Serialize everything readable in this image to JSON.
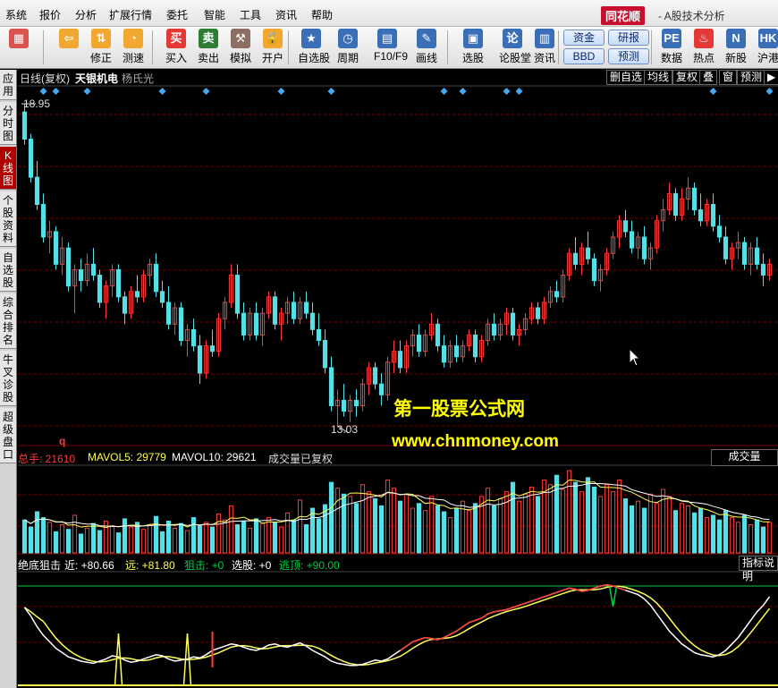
{
  "menu": [
    "系统",
    "报价",
    "分析",
    "扩展行情",
    "委托",
    "智能",
    "工具",
    "资讯",
    "帮助"
  ],
  "brand": "同花顺",
  "window_title": "- A股技术分析",
  "toolbar": {
    "buttons": [
      {
        "label": "",
        "icon": "app-grid-icon",
        "color": "#d9534f"
      },
      {
        "label": "",
        "icon": "back-arrow-icon",
        "color": "#f0a830"
      },
      {
        "label": "修正",
        "icon": "updown-arrow-icon",
        "color": "#f0a830"
      },
      {
        "label": "测速",
        "icon": "speed-icon",
        "color": "#f0a830"
      },
      {
        "label": "买入",
        "icon": "buy-icon",
        "color": "#e53935"
      },
      {
        "label": "卖出",
        "icon": "sell-icon",
        "color": "#2e7d32"
      },
      {
        "label": "模拟",
        "icon": "hammer-icon",
        "color": "#8d6e63"
      },
      {
        "label": "开户",
        "icon": "lock-icon",
        "color": "#f0a830"
      },
      {
        "label": "自选股",
        "icon": "star-icon",
        "color": "#3a6fb8"
      },
      {
        "label": "周期",
        "icon": "clock-icon",
        "color": "#3a6fb8"
      },
      {
        "label": "F10/F9",
        "icon": "doc-icon",
        "color": "#3a6fb8"
      },
      {
        "label": "画线",
        "icon": "pen-icon",
        "color": "#3a6fb8"
      },
      {
        "label": "选股",
        "icon": "select-icon",
        "color": "#3a6fb8"
      },
      {
        "label": "论股堂",
        "icon": "forum-icon",
        "color": "#3a6fb8"
      },
      {
        "label": "资讯",
        "icon": "news-icon",
        "color": "#3a6fb8"
      },
      {
        "label": "数据",
        "icon": "pe-icon",
        "color": "#3a6fb8"
      },
      {
        "label": "热点",
        "icon": "fire-icon",
        "color": "#e53935"
      },
      {
        "label": "新股",
        "icon": "newstock-icon",
        "color": "#3a6fb8"
      },
      {
        "label": "沪港",
        "icon": "hk-icon",
        "color": "#3a6fb8"
      }
    ],
    "pills": [
      "资金",
      "研报",
      "BBD",
      "预测"
    ]
  },
  "sidebar": {
    "tabs": [
      "应用",
      "分时图",
      "K线图",
      "个股资料",
      "自选股",
      "综合排名",
      "牛叉诊股",
      "超级盘口"
    ],
    "active": 2
  },
  "chart_header": {
    "period": "日线(复权)",
    "stock_name": "天银机电",
    "formula_name": "杨氏光",
    "buttons": [
      "删自选",
      "均线",
      "复权",
      "叠",
      "窗",
      "预测"
    ],
    "play_icon": "play-icon"
  },
  "price_labels": {
    "high": "18.95",
    "low": "13.03"
  },
  "watermark": {
    "line1": "第一股票公式网",
    "line2": "www.chnmoney.com"
  },
  "volume_header": {
    "total": "总手: 21610",
    "mavol5": "MAVOL5: 29779",
    "mavol10": "MAVOL10: 29621",
    "note": "成交量已复权",
    "right_label": "成交量",
    "marker": "q"
  },
  "indicator_header": {
    "name": "绝底狙击",
    "near": "近: +80.66",
    "far": "远: +81.80",
    "snipe": "狙击: +0",
    "pick": "选股: +0",
    "escape": "逃顶: +90.00",
    "help": "指标说明"
  },
  "colors": {
    "up": "#ff3a3a",
    "down": "#55dfe6",
    "grid": "#7a0000",
    "signal_diamond": "#44aaf0",
    "ma_yellow": "#ffff55",
    "ma_white": "#ffffff",
    "green": "#00cc44"
  },
  "chart_data": {
    "type": "candlestick",
    "price_range": [
      13.03,
      18.95
    ],
    "signal_candles": [
      3,
      5,
      10,
      22,
      29,
      41,
      49,
      67,
      70,
      77,
      79,
      110,
      119,
      122,
      124,
      138,
      141,
      151
    ],
    "candles": [
      [
        18.8,
        18.95,
        18.2,
        18.3
      ],
      [
        18.3,
        18.4,
        17.5,
        17.6
      ],
      [
        17.6,
        17.9,
        17.0,
        17.1
      ],
      [
        17.1,
        17.3,
        16.4,
        16.5
      ],
      [
        16.5,
        16.8,
        16.2,
        16.6
      ],
      [
        16.6,
        16.7,
        15.9,
        16.0
      ],
      [
        16.0,
        16.5,
        15.8,
        16.3
      ],
      [
        16.3,
        16.4,
        15.5,
        15.6
      ],
      [
        15.6,
        16.0,
        15.1,
        15.9
      ],
      [
        15.9,
        16.1,
        15.5,
        15.7
      ],
      [
        15.7,
        16.2,
        15.6,
        16.0
      ],
      [
        16.0,
        16.3,
        15.7,
        15.8
      ],
      [
        15.8,
        15.9,
        15.2,
        15.3
      ],
      [
        15.3,
        15.7,
        15.0,
        15.6
      ],
      [
        15.6,
        16.0,
        15.4,
        15.9
      ],
      [
        15.9,
        16.0,
        15.3,
        15.4
      ],
      [
        15.4,
        15.5,
        14.9,
        15.1
      ],
      [
        15.1,
        15.6,
        15.0,
        15.5
      ],
      [
        15.5,
        15.8,
        15.3,
        15.4
      ],
      [
        15.4,
        15.9,
        15.3,
        15.8
      ],
      [
        15.8,
        16.1,
        15.6,
        16.0
      ],
      [
        16.0,
        16.2,
        15.4,
        15.5
      ],
      [
        15.5,
        15.7,
        15.2,
        15.3
      ],
      [
        15.3,
        15.6,
        14.8,
        14.9
      ],
      [
        14.9,
        15.3,
        14.7,
        15.2
      ],
      [
        15.2,
        15.3,
        14.5,
        14.6
      ],
      [
        14.6,
        14.9,
        14.3,
        14.8
      ],
      [
        14.8,
        15.0,
        14.4,
        14.5
      ],
      [
        14.5,
        14.7,
        13.8,
        14.0
      ],
      [
        14.0,
        14.6,
        13.9,
        14.5
      ],
      [
        14.5,
        14.8,
        14.3,
        14.4
      ],
      [
        14.4,
        15.1,
        14.3,
        15.0
      ],
      [
        15.0,
        15.4,
        14.8,
        15.3
      ],
      [
        15.3,
        16.0,
        15.2,
        15.8
      ],
      [
        15.8,
        16.0,
        15.0,
        15.1
      ],
      [
        15.1,
        15.3,
        14.6,
        14.7
      ],
      [
        14.7,
        15.2,
        14.6,
        15.1
      ],
      [
        15.1,
        15.3,
        14.6,
        14.7
      ],
      [
        14.7,
        15.2,
        14.5,
        15.1
      ],
      [
        15.1,
        15.5,
        15.0,
        15.4
      ],
      [
        15.4,
        15.5,
        14.8,
        14.9
      ],
      [
        14.9,
        15.2,
        14.6,
        15.1
      ],
      [
        15.1,
        15.4,
        14.9,
        15.3
      ],
      [
        15.3,
        15.5,
        14.9,
        15.0
      ],
      [
        15.0,
        15.4,
        14.9,
        15.3
      ],
      [
        15.3,
        15.5,
        15.0,
        15.1
      ],
      [
        15.1,
        15.3,
        14.7,
        14.8
      ],
      [
        14.8,
        15.1,
        14.5,
        14.6
      ],
      [
        14.6,
        14.8,
        14.0,
        14.1
      ],
      [
        14.1,
        14.3,
        13.3,
        13.4
      ],
      [
        13.4,
        13.7,
        13.03,
        13.5
      ],
      [
        13.5,
        13.8,
        13.2,
        13.3
      ],
      [
        13.3,
        13.6,
        13.1,
        13.5
      ],
      [
        13.5,
        13.7,
        13.2,
        13.4
      ],
      [
        13.4,
        13.9,
        13.3,
        13.8
      ],
      [
        13.8,
        14.2,
        13.6,
        14.1
      ],
      [
        14.1,
        14.2,
        13.7,
        13.8
      ],
      [
        13.8,
        14.0,
        13.4,
        13.6
      ],
      [
        13.6,
        14.3,
        13.5,
        14.2
      ],
      [
        14.2,
        14.6,
        14.0,
        14.4
      ],
      [
        14.4,
        14.6,
        14.0,
        14.1
      ],
      [
        14.1,
        14.6,
        14.0,
        14.5
      ],
      [
        14.5,
        14.8,
        14.3,
        14.7
      ],
      [
        14.7,
        14.9,
        14.3,
        14.4
      ],
      [
        14.4,
        14.8,
        14.3,
        14.7
      ],
      [
        14.7,
        15.1,
        14.6,
        14.9
      ],
      [
        14.9,
        15.0,
        14.4,
        14.5
      ],
      [
        14.5,
        14.7,
        14.1,
        14.2
      ],
      [
        14.2,
        14.6,
        14.1,
        14.5
      ],
      [
        14.5,
        14.7,
        14.2,
        14.3
      ],
      [
        14.3,
        14.6,
        14.2,
        14.5
      ],
      [
        14.5,
        14.8,
        14.4,
        14.7
      ],
      [
        14.7,
        14.8,
        14.2,
        14.3
      ],
      [
        14.3,
        14.7,
        14.2,
        14.6
      ],
      [
        14.6,
        15.0,
        14.5,
        14.9
      ],
      [
        14.9,
        15.1,
        14.6,
        14.7
      ],
      [
        14.7,
        15.0,
        14.6,
        14.9
      ],
      [
        14.9,
        15.2,
        14.7,
        15.1
      ],
      [
        15.1,
        15.2,
        14.6,
        14.7
      ],
      [
        14.7,
        14.9,
        14.5,
        14.8
      ],
      [
        14.8,
        15.1,
        14.7,
        15.0
      ],
      [
        15.0,
        15.3,
        14.9,
        15.2
      ],
      [
        15.2,
        15.3,
        14.9,
        15.0
      ],
      [
        15.0,
        15.4,
        14.9,
        15.3
      ],
      [
        15.3,
        15.6,
        15.2,
        15.5
      ],
      [
        15.5,
        15.7,
        15.3,
        15.4
      ],
      [
        15.4,
        15.9,
        15.3,
        15.8
      ],
      [
        15.8,
        16.3,
        15.7,
        16.2
      ],
      [
        16.2,
        16.5,
        15.9,
        16.0
      ],
      [
        16.0,
        16.4,
        15.8,
        16.3
      ],
      [
        16.3,
        16.6,
        16.0,
        16.1
      ],
      [
        16.1,
        16.2,
        15.6,
        15.7
      ],
      [
        15.7,
        16.0,
        15.5,
        15.9
      ],
      [
        15.9,
        16.3,
        15.8,
        16.2
      ],
      [
        16.2,
        16.6,
        16.1,
        16.5
      ],
      [
        16.5,
        16.9,
        16.3,
        16.8
      ],
      [
        16.8,
        17.0,
        16.5,
        16.6
      ],
      [
        16.6,
        16.8,
        16.2,
        16.3
      ],
      [
        16.3,
        16.6,
        16.1,
        16.5
      ],
      [
        16.5,
        16.7,
        16.0,
        16.1
      ],
      [
        16.1,
        16.4,
        15.9,
        16.3
      ],
      [
        16.3,
        16.9,
        16.2,
        16.8
      ],
      [
        16.8,
        17.2,
        16.6,
        17.0
      ],
      [
        17.0,
        17.5,
        16.9,
        17.3
      ],
      [
        17.3,
        17.4,
        16.8,
        16.9
      ],
      [
        16.9,
        17.4,
        16.8,
        17.2
      ],
      [
        17.2,
        17.6,
        17.0,
        17.4
      ],
      [
        17.4,
        17.5,
        16.9,
        17.0
      ],
      [
        17.0,
        17.3,
        16.7,
        16.8
      ],
      [
        16.8,
        17.2,
        16.7,
        17.1
      ],
      [
        17.1,
        17.3,
        16.6,
        16.7
      ],
      [
        16.7,
        16.9,
        16.4,
        16.5
      ],
      [
        16.5,
        16.7,
        16.0,
        16.1
      ],
      [
        16.1,
        16.4,
        15.9,
        16.3
      ],
      [
        16.3,
        16.6,
        16.1,
        16.4
      ],
      [
        16.4,
        16.5,
        15.9,
        16.0
      ],
      [
        16.0,
        16.4,
        15.8,
        16.3
      ],
      [
        16.3,
        16.5,
        15.9,
        16.0
      ],
      [
        16.0,
        16.2,
        15.6,
        15.8
      ],
      [
        15.8,
        16.1,
        15.7,
        16.0
      ]
    ],
    "volume": [
      28,
      22,
      35,
      30,
      26,
      18,
      24,
      20,
      32,
      16,
      21,
      25,
      19,
      27,
      23,
      17,
      29,
      22,
      26,
      20,
      24,
      31,
      18,
      27,
      21,
      25,
      19,
      30,
      23,
      26,
      22,
      33,
      28,
      40,
      24,
      27,
      21,
      29,
      25,
      30,
      26,
      22,
      34,
      28,
      45,
      24,
      38,
      29,
      41,
      60,
      55,
      50,
      48,
      42,
      58,
      52,
      46,
      40,
      62,
      55,
      44,
      50,
      38,
      42,
      36,
      48,
      40,
      35,
      30,
      38,
      44,
      36,
      42,
      48,
      55,
      40,
      46,
      52,
      60,
      44,
      50,
      56,
      48,
      62,
      58,
      66,
      54,
      70,
      60,
      52,
      64,
      56,
      48,
      58,
      52,
      62,
      46,
      40,
      44,
      38,
      50,
      42,
      54,
      48,
      36,
      42,
      40,
      34,
      38,
      30,
      32,
      28,
      36,
      30,
      26,
      32,
      24,
      28,
      22,
      26
    ],
    "indicator": {
      "near": [
        70,
        62,
        52,
        44,
        38,
        32,
        28,
        24,
        22,
        20,
        19,
        18,
        20,
        22,
        25,
        24,
        21,
        19,
        20,
        22,
        24,
        26,
        25,
        22,
        20,
        21,
        22,
        24,
        23,
        26,
        30,
        32,
        34,
        36,
        35,
        33,
        31,
        30,
        32,
        35,
        36,
        34,
        33,
        35,
        37,
        34,
        30,
        27,
        24,
        20,
        18,
        17,
        16,
        16,
        17,
        19,
        21,
        20,
        22,
        26,
        30,
        34,
        38,
        40,
        42,
        41,
        40,
        42,
        45,
        48,
        52,
        56,
        58,
        60,
        64,
        66,
        67,
        68,
        70,
        72,
        74,
        76,
        78,
        80,
        82,
        84,
        86,
        88,
        87,
        85,
        86,
        88,
        90,
        91,
        90,
        88,
        86,
        84,
        82,
        78,
        72,
        64,
        56,
        48,
        42,
        36,
        32,
        28,
        26,
        25,
        24,
        26,
        30,
        36,
        42,
        50,
        58,
        66,
        72,
        80
      ]
    }
  }
}
